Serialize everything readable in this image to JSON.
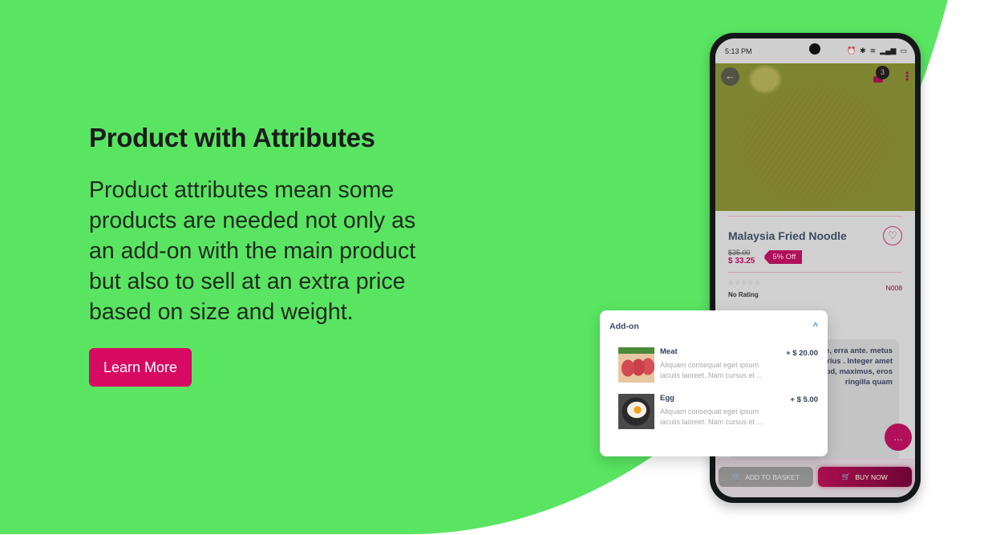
{
  "hero": {
    "title": "Product with Attributes",
    "description": "Product attributes mean some products are needed not only as an add-on with the main product but also to sell at an extra price based on size and weight.",
    "cta_label": "Learn More"
  },
  "colors": {
    "background_green": "#59e562",
    "brand_pink": "#d80962",
    "product_accent": "#b0105a"
  },
  "phone": {
    "status_bar": {
      "time": "5:13 PM",
      "icons": [
        "alarm-icon",
        "bluetooth-icon",
        "wifi-icon",
        "signal-icon",
        "battery-icon"
      ]
    },
    "header": {
      "back_icon": "←",
      "cart_count": "3",
      "more_icon": "⋮"
    },
    "product": {
      "name": "Malaysia Fried Noodle",
      "old_price": "$35.00",
      "new_price": "$ 33.25",
      "discount": "5% Off",
      "stars": "☆☆☆☆☆",
      "rating_text": "No Rating",
      "sku": "N008",
      "favorite_icon": "♡",
      "description_visible": "us fermentum. elerisque, erra ante. metus in obortis neque. r varius . Integer amet laoreet Etiam euismod, maximus, eros ringilla quam"
    },
    "chat_icon": "…",
    "bottom_bar": {
      "add_to_basket": "ADD TO BASKET",
      "buy_now": "BUY NOW"
    }
  },
  "addon": {
    "title": "Add-on",
    "items": [
      {
        "name": "Meat",
        "price": "+ $ 20.00",
        "description": "Aliquam consequat eget ipsum iaculis laoreet. Nam cursus et ..."
      },
      {
        "name": "Egg",
        "price": "+ $ 5.00",
        "description": "Aliquam consequat eget ipsum iaculis laoreet. Nam cursus et ..."
      }
    ]
  }
}
